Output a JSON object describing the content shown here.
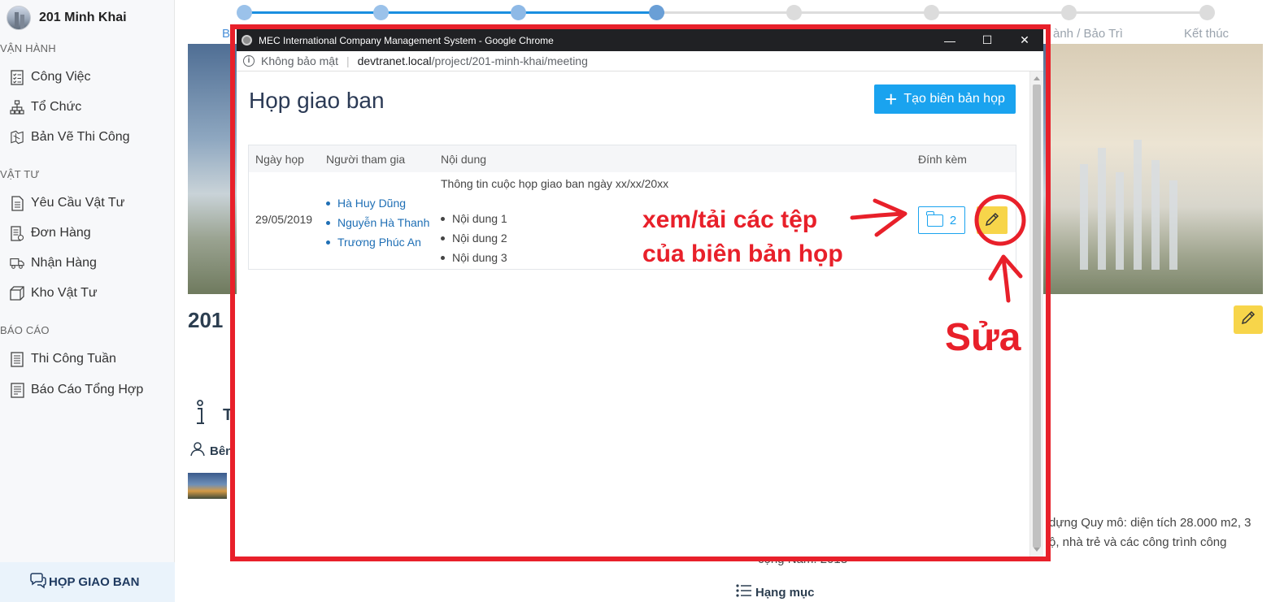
{
  "sidebar": {
    "project_name": "201 Minh Khai",
    "sections": [
      {
        "label": "VẬN HÀNH",
        "items": [
          "Công Việc",
          "Tổ Chức",
          "Bản Vẽ Thi Công"
        ]
      },
      {
        "label": "VẬT TƯ",
        "items": [
          "Yêu Cầu Vật Tư",
          "Đơn Hàng",
          "Nhận Hàng",
          "Kho Vật Tư"
        ]
      },
      {
        "label": "BÁO CÁO",
        "items": [
          "Thi Công Tuần",
          "Báo Cáo Tổng Hợp"
        ]
      }
    ],
    "meeting_tab": "HỌP GIAO BAN"
  },
  "background": {
    "stepper_labels": [
      "B",
      "ành / Bảo Trì",
      "Kết thúc"
    ],
    "project_title": "201",
    "t_heading": "T",
    "ben_label": "Bên",
    "desc_line1": "dựng Quy mô: diện tích 28.000 m2, 3",
    "desc_line2": "ộ, nhà trẻ và các công trình công",
    "desc_line3": "cộng Năm: 2018",
    "hangmuc": "Hạng mục",
    "colors": {
      "step_done": "#6aa0d8",
      "step_line_done": "#1a8fe0",
      "step_todo": "#dcdcdc",
      "edit_yellow": "#f7d54a"
    }
  },
  "window": {
    "title": "MEC International Company Management System - Google Chrome",
    "security": "Không bảo mật",
    "url_host": "devtranet.local",
    "url_path": "/project/201-minh-khai/meeting",
    "controls": {
      "minimize": "—",
      "maximize": "☐",
      "close": "✕"
    }
  },
  "page": {
    "heading": "Họp giao ban",
    "create_button": "Tạo biên bản họp",
    "table": {
      "headers": [
        "Ngày họp",
        "Người tham gia",
        "Nội dung",
        "Đính kèm"
      ],
      "rows": [
        {
          "date": "29/05/2019",
          "participants": [
            "Hà Huy Dũng",
            "Nguyễn Hà Thanh",
            "Trương Phúc An"
          ],
          "content_title": "Thông tin cuộc họp giao ban ngày xx/xx/20xx",
          "content_items": [
            "Nội dung 1",
            "Nội dung 2",
            "Nội dung 3"
          ],
          "attachments_count": "2"
        }
      ]
    },
    "accent": "#1aa3ef"
  },
  "annotations": {
    "attach_note_line1": "xem/tải các tệp",
    "attach_note_line2": "của biên bản họp",
    "edit_note": "Sửa",
    "color": "#e8202a"
  }
}
